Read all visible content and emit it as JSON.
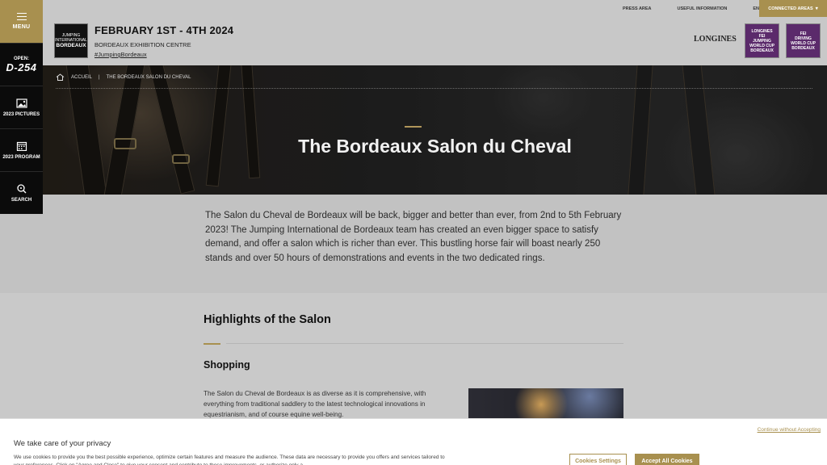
{
  "sidebar": {
    "menu_label": "MENU",
    "countdown_label": "OPEN:",
    "countdown_value": "D-254",
    "pictures_label": "2023 PICTURES",
    "program_label": "2023 PROGRAM",
    "search_label": "SEARCH"
  },
  "header": {
    "event_date": "FEBRUARY 1ST - 4TH 2024",
    "venue": "BORDEAUX EXHIBITION CENTRE",
    "hashtag": "#JumpingBordeaux",
    "logo_line1": "JUMPING",
    "logo_line2": "INTERNATIONAL",
    "logo_line3": "BORDEAUX",
    "topnav": [
      "PRESS AREA",
      "USEFUL INFORMATION",
      "EN"
    ],
    "connected_label": "CONNECTED AREAS",
    "longines": "LONGINES",
    "badge1_lines": [
      "LONGINES",
      "FEI",
      "JUMPING",
      "WORLD CUP",
      "BORDEAUX"
    ],
    "badge2_lines": [
      "FEI",
      "DRIVING",
      "WORLD CUP",
      "BORDEAUX"
    ]
  },
  "hero": {
    "breadcrumb_home": "ACCUEIL",
    "breadcrumb_current": "THE BORDEAUX SALON DU CHEVAL",
    "title": "The Bordeaux Salon du Cheval"
  },
  "intro": {
    "text": "The Salon du Cheval de Bordeaux will be back, bigger and better than ever, from 2nd to 5th February 2023! The Jumping International de Bordeaux team has created an even bigger space to satisfy demand, and offer a salon which is richer than ever. This bustling horse fair will boast nearly 250 stands and over 50 hours of demonstrations and events in the two dedicated rings."
  },
  "highlights": {
    "title": "Highlights of the Salon",
    "shopping_title": "Shopping",
    "shopping_text": "The Salon du Cheval de Bordeaux is as diverse as it is comprehensive, with everything from traditional saddlery to the latest technological innovations in equestrianism, and of course equine well-being."
  },
  "cookie": {
    "continue_label": "Continue without Accepting",
    "title": "We take care of your privacy",
    "text": "We use cookies to provide you the best possible experience, optimize certain features and measure the audience. These data are necessary to provide you offers and services tailored to your preferences. Click on \"Agree and Close\" to give your consent and contribute to these improvements, or authorize only a",
    "settings_label": "Cookies Settings",
    "accept_label": "Accept All Cookies"
  },
  "colors": {
    "accent": "#a8904f",
    "sidebar": "#0b0b0b"
  }
}
